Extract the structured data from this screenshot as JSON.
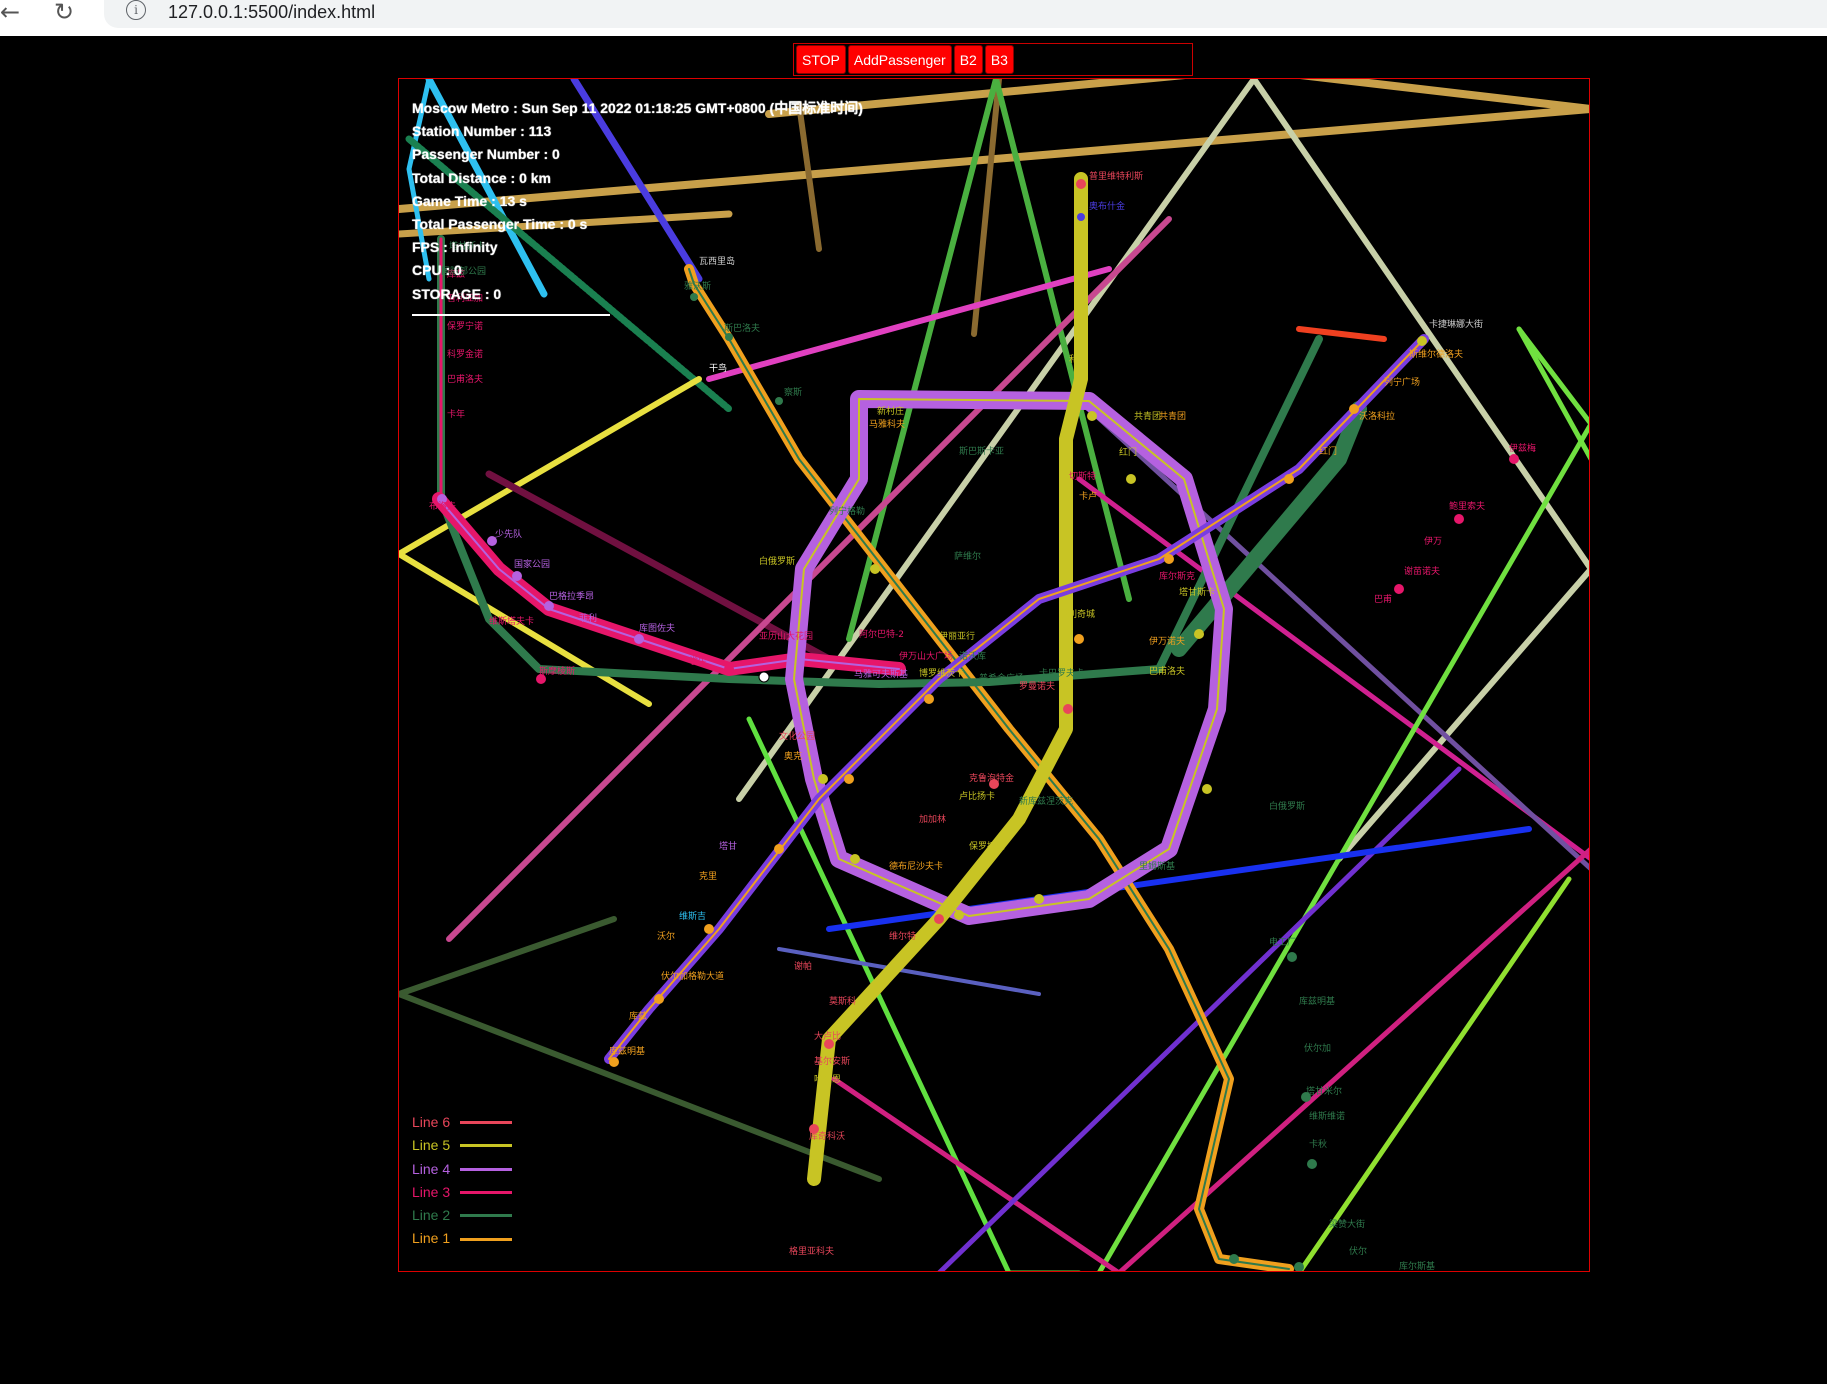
{
  "browser": {
    "back_icon": "arrow-left-icon",
    "reload_icon": "reload-icon",
    "info_icon": "info-icon",
    "url": "127.0.0.1:5500/index.html"
  },
  "toolbar": {
    "buttons": [
      "STOP",
      "AddPassenger",
      "B2",
      "B3"
    ]
  },
  "stats": {
    "title_line": "Moscow Metro :  Sun Sep 11 2022 01:18:25 GMT+0800 (中国标准时间)",
    "station_number": "Station Number : 113",
    "passenger_number": "Passenger Number : 0",
    "total_distance": "Total Distance : 0 km",
    "game_time": "Game Time : 13 s",
    "total_passenger_time": "Total Passenger Time : 0 s",
    "fps": "FPS : Infinity",
    "cpu": "CPU : 0",
    "storage": "STORAGE : 0"
  },
  "legend": [
    {
      "label": "Line  6",
      "color": "#e8465a"
    },
    {
      "label": "Line  5",
      "color": "#c8c424"
    },
    {
      "label": "Line  4",
      "color": "#b561e0"
    },
    {
      "label": "Line  3",
      "color": "#e6166a"
    },
    {
      "label": "Line  2",
      "color": "#2f7a4c"
    },
    {
      "label": "Line  1",
      "color": "#f0a01e"
    }
  ],
  "colors": {
    "background": "#000000",
    "border": "#dd0000",
    "button": "#ff0000"
  }
}
